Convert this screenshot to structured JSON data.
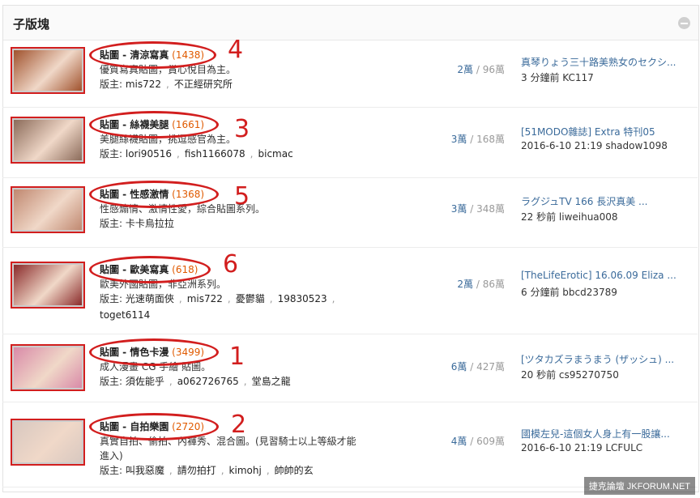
{
  "header": {
    "title": "子版塊"
  },
  "forums": [
    {
      "name": "貼圖 - 清涼寫真",
      "count": "(1438)",
      "desc": "優質寫真貼圖，賞心悅目為主。",
      "mod_label": "版主:",
      "mods": [
        "mis722",
        "不正經研究所"
      ],
      "mods2": [],
      "stat_a": "2萬",
      "stat_sep": " / ",
      "stat_b": "96萬",
      "last_title": "真琴りょう三十路美熟女のセクシ...",
      "last_meta": "3 分鐘前 KC117",
      "rank": "4",
      "thumb_color": "#a0522d"
    },
    {
      "name": "貼圖 - 絲襪美腿",
      "count": "(1661)",
      "desc": "美腿絲襪貼圖，挑逗感官為主。",
      "mod_label": "版主:",
      "mods": [
        "lori90516",
        "fish1166078",
        "bicmac"
      ],
      "mods2": [],
      "stat_a": "3萬",
      "stat_sep": " / ",
      "stat_b": "168萬",
      "last_title": "[51MODO雜誌] Extra 特刊05",
      "last_meta": "2016-6-10 21:19 shadow1098",
      "rank": "3",
      "thumb_color": "#8b6b5a"
    },
    {
      "name": "貼圖 - 性感激情",
      "count": "(1368)",
      "desc": "性感煽情、激情性愛，綜合貼圖系列。",
      "mod_label": "版主:",
      "mods": [
        "卡卡烏拉拉"
      ],
      "mods2": [],
      "stat_a": "3萬",
      "stat_sep": " / ",
      "stat_b": "348萬",
      "last_title": "ラグジュTV 166 長沢真美 ...",
      "last_meta": "22 秒前 liweihua008",
      "rank": "5",
      "thumb_color": "#c08870"
    },
    {
      "name": "貼圖 - 歐美寫真",
      "count": "(618)",
      "desc": "歐美外國貼圖，非亞洲系列。",
      "mod_label": "版主:",
      "mods": [
        "光速萌面俠",
        "mis722",
        "憂鬱貓",
        "19830523"
      ],
      "mods2": [
        "toget6114"
      ],
      "stat_a": "2萬",
      "stat_sep": " / ",
      "stat_b": "86萬",
      "last_title": "[TheLifeErotic] 16.06.09 Eliza ...",
      "last_meta": "6 分鐘前 bbcd23789",
      "rank": "6",
      "thumb_color": "#8a2a2a"
    },
    {
      "name": "貼圖 - 情色卡漫",
      "count": "(3499)",
      "desc": "成人漫畫 CG 手繪 貼圖。",
      "mod_label": "版主:",
      "mods": [
        "須佐能乎",
        "a062726765",
        "堂島之龍"
      ],
      "mods2": [],
      "stat_a": "6萬",
      "stat_sep": " / ",
      "stat_b": "427萬",
      "last_title": "[ツタカズラまうまう (ザッシュ) ...",
      "last_meta": "20 秒前 cs95270750",
      "rank": "1",
      "thumb_color": "#d98aa8"
    },
    {
      "name": "貼圖 - 自拍樂園",
      "count": "(2720)",
      "desc": "真實自拍、偷拍、內褲秀、混合圖。(見習騎士以上等級才能",
      "desc2": "進入)",
      "mod_label": "版主:",
      "mods": [
        "叫我惡魔",
        "請勿拍打",
        "kimohj",
        "帥帥的玄"
      ],
      "mods2": [],
      "stat_a": "4萬",
      "stat_sep": " / ",
      "stat_b": "609萬",
      "last_title": "國模左兒-這個女人身上有一股讓...",
      "last_meta": "2016-6-10 21:19 LCFULC",
      "rank": "2",
      "thumb_color": "#d8c8c0"
    }
  ],
  "watermark": "捷克論壇 JKFORUM.NET"
}
